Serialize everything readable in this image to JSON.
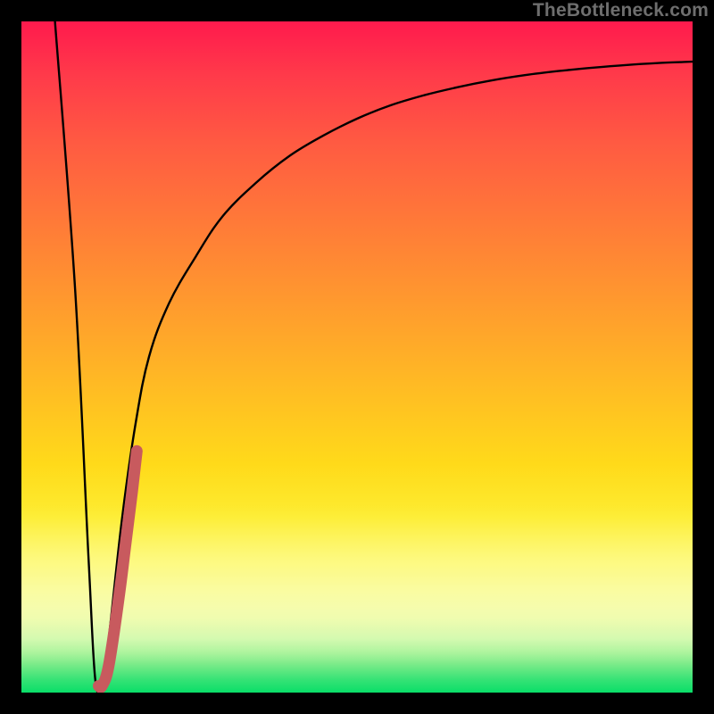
{
  "watermark": {
    "text": "TheBottleneck.com"
  },
  "colors": {
    "frame": "#000000",
    "curve": "#000000",
    "highlight": "#c85a5e",
    "gradient_top": "#ff1a4d",
    "gradient_bottom": "#09de68"
  },
  "chart_data": {
    "type": "line",
    "title": "",
    "xlabel": "",
    "ylabel": "",
    "xlim": [
      0,
      100
    ],
    "ylim": [
      0,
      100
    ],
    "grid": false,
    "series": [
      {
        "name": "bottleneck-curve",
        "x": [
          5,
          8,
          10,
          11,
          12,
          13,
          15,
          17,
          19,
          22,
          26,
          30,
          35,
          40,
          45,
          50,
          55,
          60,
          65,
          70,
          75,
          80,
          85,
          90,
          95,
          100
        ],
        "y": [
          100,
          60,
          20,
          2,
          1,
          8,
          26,
          40,
          50,
          58,
          65,
          71,
          76,
          80,
          83,
          85.5,
          87.5,
          89,
          90.2,
          91.2,
          92,
          92.6,
          93.1,
          93.5,
          93.8,
          94
        ]
      },
      {
        "name": "highlight-segment",
        "x": [
          11.5,
          12,
          13,
          14.5,
          15.5,
          16.5,
          17.2
        ],
        "y": [
          1,
          1,
          4,
          14,
          22,
          30,
          36
        ]
      }
    ],
    "annotations": []
  }
}
